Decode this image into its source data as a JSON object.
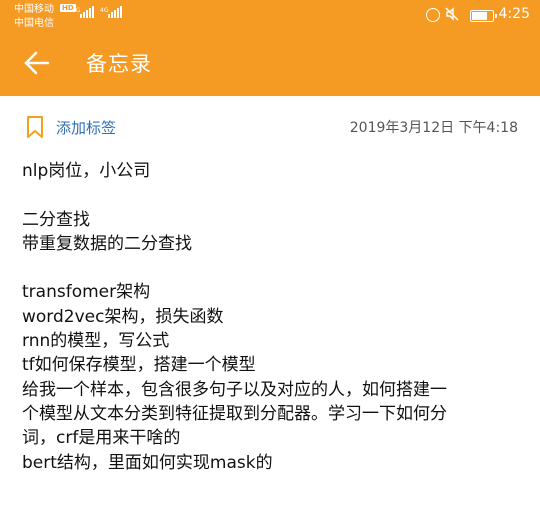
{
  "status_bar": {
    "carrier1": "中国移动",
    "hd": "HD",
    "net1": "4G",
    "net2": "4G",
    "carrier2": "中国电信",
    "time": "4:25"
  },
  "header": {
    "title": "备忘录",
    "background_color": "#f59a23"
  },
  "tag_row": {
    "add_tag_label": "添加标签",
    "date": "2019年3月12日 下午4:18"
  },
  "note": {
    "lines": [
      "nlp岗位，小公司",
      "",
      "二分查找",
      "带重复数据的二分查找",
      "",
      "transfomer架构",
      "word2vec架构，损失函数",
      "rnn的模型，写公式",
      "tf如何保存模型，搭建一个模型",
      "给我一个样本，包含很多句子以及对应的人，如何搭建一",
      "个模型从文本分类到特征提取到分配器。学习一下如何分",
      "词，crf是用来干啥的",
      "bert结构，里面如何实现mask的"
    ]
  },
  "icons": {
    "back": "arrow-left-icon",
    "bookmark": "bookmark-icon",
    "alarm": "alarm-icon",
    "mute": "mute-icon",
    "battery": "battery-icon"
  }
}
